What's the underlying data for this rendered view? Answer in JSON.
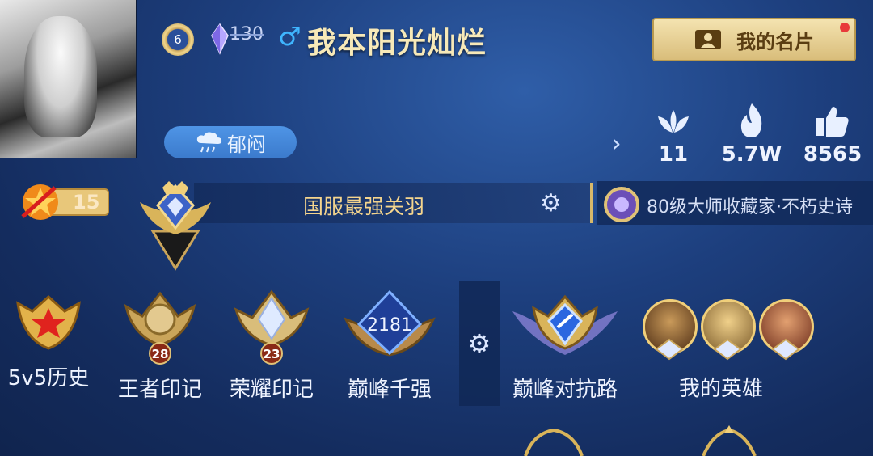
{
  "header": {
    "player_level": "6",
    "crystal_count": "130",
    "gender_symbol": "♂",
    "player_name": "我本阳光灿烂",
    "card_button_label": "我的名片",
    "mood": "郁闷"
  },
  "stats": [
    {
      "icon": "lotus-icon",
      "value": "11"
    },
    {
      "icon": "flame-icon",
      "value": "5.7W"
    },
    {
      "icon": "thumbs-up-icon",
      "value": "8565"
    }
  ],
  "rank": {
    "level_badge": "15",
    "title": "国服最强关羽",
    "collector_title": "80级大师收藏家·不朽史诗"
  },
  "achievements": [
    {
      "label": "5v5历史",
      "badge": ""
    },
    {
      "label": "王者印记",
      "badge": "28"
    },
    {
      "label": "荣耀印记",
      "badge": "23"
    },
    {
      "label": "巅峰千强",
      "badge": "2181"
    }
  ],
  "peak_road": {
    "label": "巅峰对抗路"
  },
  "my_heroes": {
    "label": "我的英雄"
  },
  "colors": {
    "gold": "#f5d58d",
    "panel": "#142c5e",
    "accent_blue": "#3fb6ff"
  }
}
